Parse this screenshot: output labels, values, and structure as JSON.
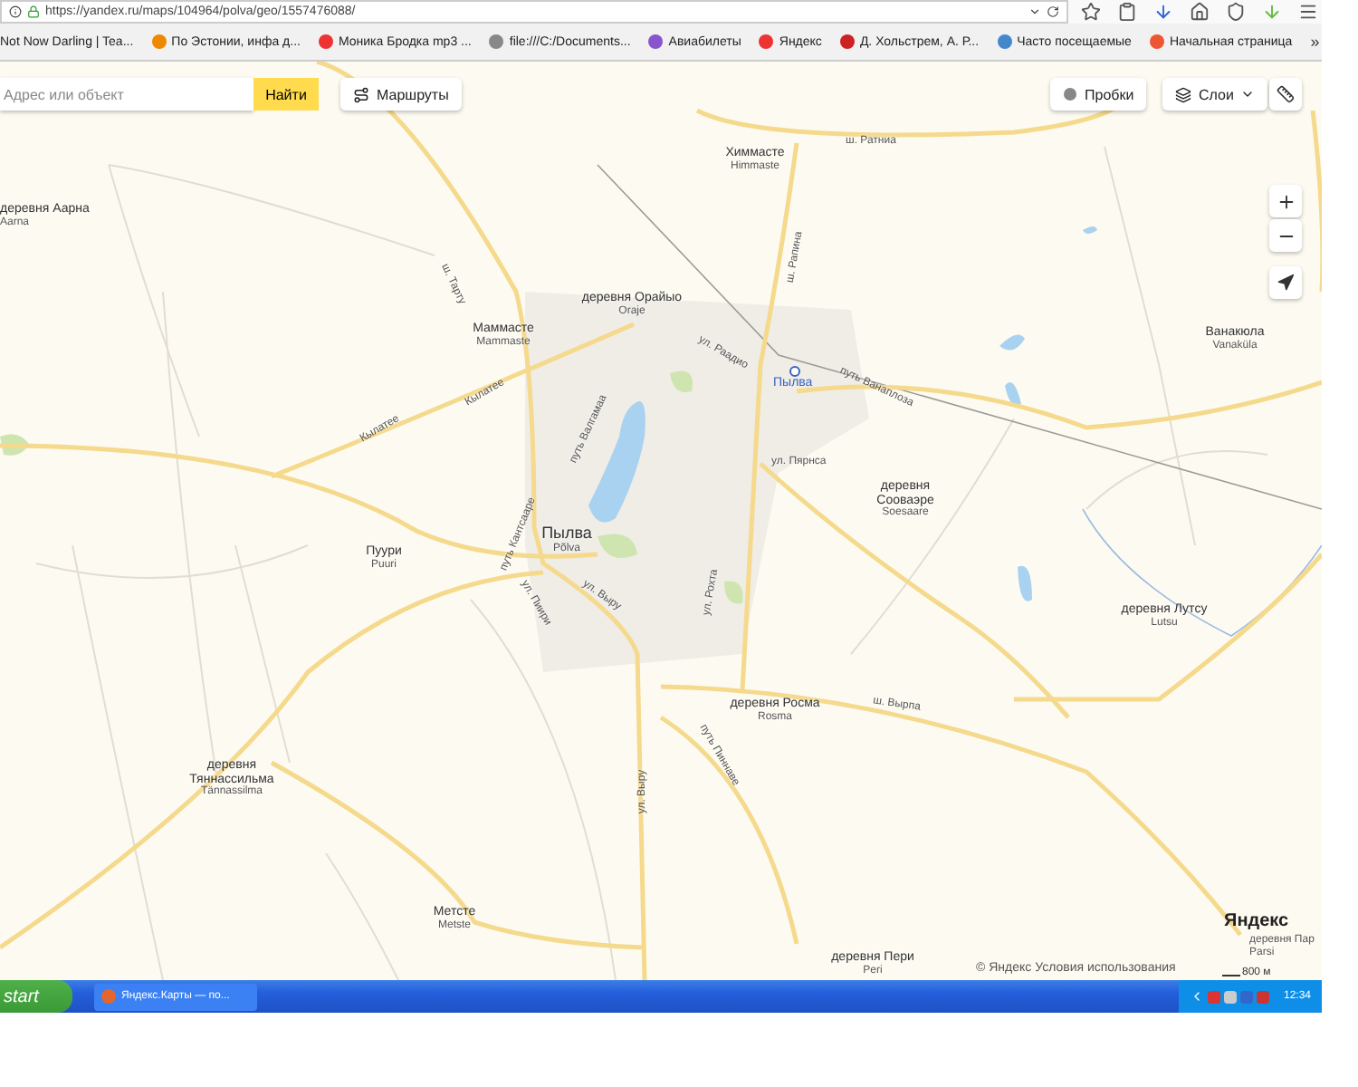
{
  "browser": {
    "url": "https://yandex.ru/maps/104964/polva/geo/1557476088/",
    "bookmarks": [
      {
        "label": "Not Now Darling | Tea..."
      },
      {
        "label": "По Эстонии, инфа д..."
      },
      {
        "label": "Моника Бродка mp3 ..."
      },
      {
        "label": "file:///C:/Documents..."
      },
      {
        "label": "Авиабилеты"
      },
      {
        "label": "Яндекс"
      },
      {
        "label": "Д. Хольстрем, А. Р..."
      },
      {
        "label": "Часто посещаемые"
      },
      {
        "label": "Начальная страница"
      }
    ],
    "more": "»"
  },
  "map_toolbar": {
    "search": {
      "placeholder": "Адрес или объект"
    },
    "search_button": "Найти",
    "routes_button": "Маршруты",
    "traffic_button": "Пробки",
    "layers_button": "Слои"
  },
  "map": {
    "places": [
      {
        "lines": [
          "деревня Аарна",
          "Aarna"
        ]
      },
      {
        "lines": [
          "Химмасте",
          "Himmaste"
        ]
      },
      {
        "lines": [
          "деревня Орайыо",
          "Oraje"
        ]
      },
      {
        "lines": [
          "Маммасте",
          "Mammaste"
        ]
      },
      {
        "lines": [
          "Ванакюла",
          "Vanaküla"
        ]
      },
      {
        "lines": [
          "деревня",
          "Сооваэре",
          "Soesaare"
        ]
      },
      {
        "lines": [
          "Пылва",
          "Põlva"
        ]
      },
      {
        "lines": [
          "Пуури",
          "Puuri"
        ]
      },
      {
        "lines": [
          "деревня Лутсу",
          "Lutsu"
        ]
      },
      {
        "lines": [
          "деревня Росма",
          "Rosma"
        ]
      },
      {
        "lines": [
          "деревня",
          "Тяннассильма",
          "Tännassilma"
        ]
      },
      {
        "lines": [
          "Метсте",
          "Metste"
        ]
      },
      {
        "lines": [
          "деревня Пери",
          "Peri"
        ]
      },
      {
        "lines": [
          "деревня Пар",
          "Parsi"
        ]
      }
    ],
    "station": "Пылва",
    "streets": [
      "ш. Тарту",
      "Кылатее",
      "Кылатее",
      "ш. Ратниа",
      "ш. Рапина",
      "ул. Раадио",
      "путь Ванаплоза",
      "ул. Пярнса",
      "путь Валгамаа",
      "путь Кантсааре",
      "ул. Выру",
      "ул. Пиири",
      "ул. Рохта",
      "ул. Выру",
      "ш. Вырпа",
      "путь Пиннаве"
    ],
    "logo": "Яндекс",
    "copyright": "© Яндекс Условия использования",
    "scale": "800 м"
  },
  "taskbar": {
    "start": "start",
    "windows": [
      {
        "label": "Яндекс.Карты — по..."
      }
    ],
    "clock": "12:34"
  }
}
